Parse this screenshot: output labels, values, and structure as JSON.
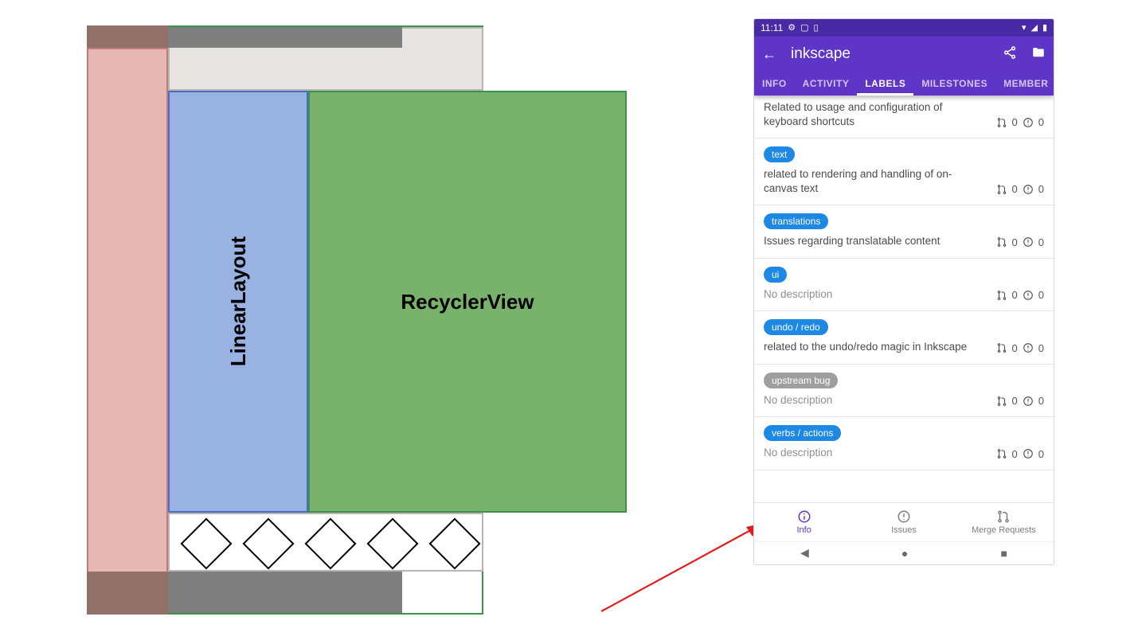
{
  "diagram": {
    "linear_label": "LinearLayout",
    "recycler_label": "RecyclerView"
  },
  "phone": {
    "status_time": "11:11",
    "title": "inkscape",
    "tabs": [
      "INFO",
      "ACTIVITY",
      "LABELS",
      "MILESTONES",
      "MEMBER"
    ],
    "active_tab_index": 2,
    "top_fragment_desc": "Related to usage and configuration of keyboard shortcuts",
    "top_fragment_mr": "0",
    "top_fragment_issues": "0",
    "labels": [
      {
        "name": "text",
        "color": "#1e88e5",
        "desc": "related to rendering and handling of on-canvas text",
        "none": false,
        "mr": "0",
        "issues": "0"
      },
      {
        "name": "translations",
        "color": "#1e88e5",
        "desc": "Issues regarding translatable content",
        "none": false,
        "mr": "0",
        "issues": "0"
      },
      {
        "name": "ui",
        "color": "#1e88e5",
        "desc": "No description",
        "none": true,
        "mr": "0",
        "issues": "0"
      },
      {
        "name": "undo / redo",
        "color": "#1e88e5",
        "desc": "related to the undo/redo magic in Inkscape",
        "none": false,
        "mr": "0",
        "issues": "0"
      },
      {
        "name": "upstream bug",
        "color": "#9e9e9e",
        "desc": "No description",
        "none": true,
        "mr": "0",
        "issues": "0"
      },
      {
        "name": "verbs / actions",
        "color": "#1e88e5",
        "desc": "No description",
        "none": true,
        "mr": "0",
        "issues": "0"
      }
    ],
    "bottom_tabs": [
      {
        "label": "Info",
        "active": true
      },
      {
        "label": "Issues",
        "active": false
      },
      {
        "label": "Merge Requests",
        "active": false
      }
    ]
  }
}
